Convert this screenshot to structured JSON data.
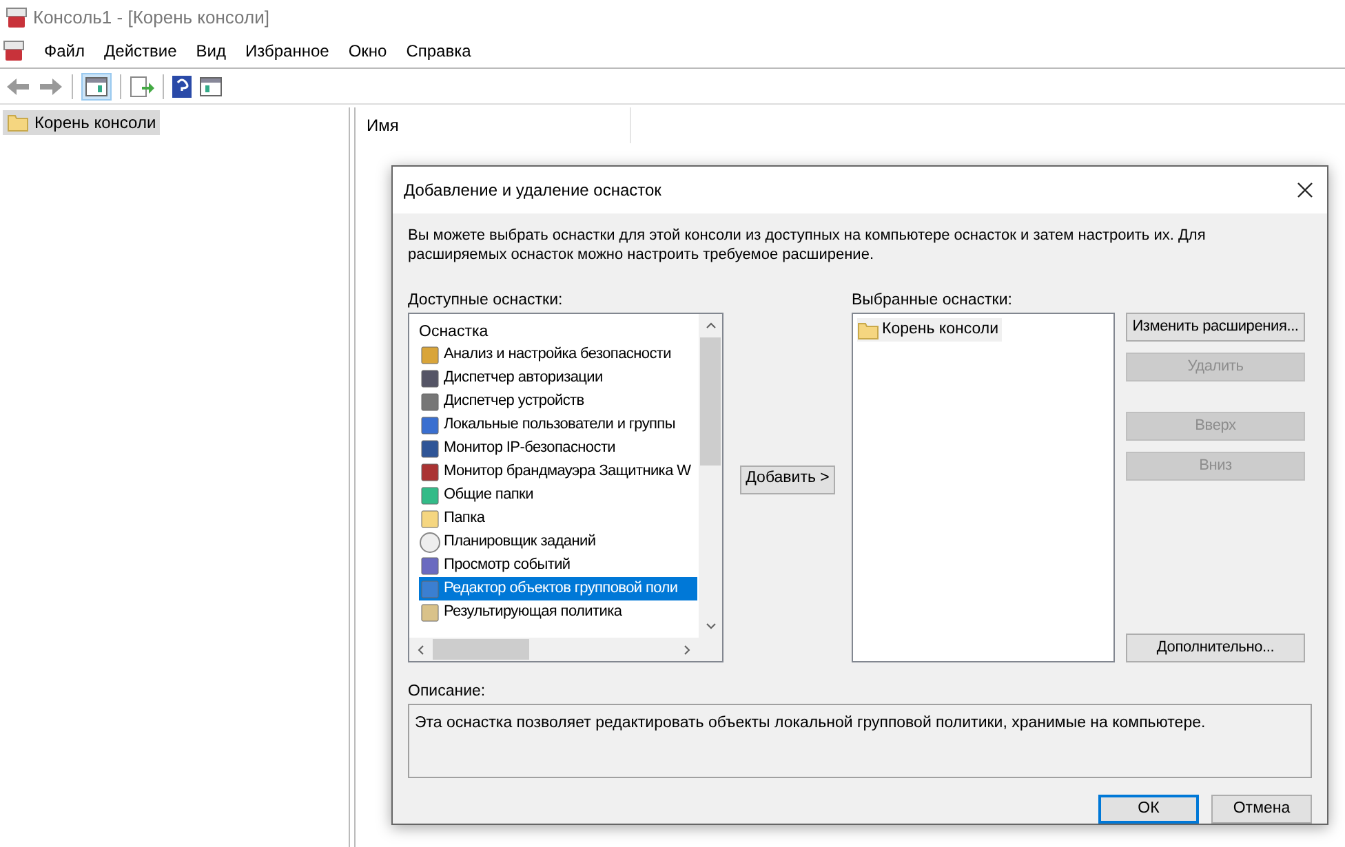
{
  "window": {
    "title": "Консоль1 - [Корень консоли]"
  },
  "menu": [
    "Файл",
    "Действие",
    "Вид",
    "Избранное",
    "Окно",
    "Справка"
  ],
  "toolbar": {
    "tree_toggle_on": true
  },
  "tree": [
    {
      "label": "Корень консоли",
      "selected": true
    }
  ],
  "list_header": "Имя",
  "dialog": {
    "title": "Добавление и удаление оснасток",
    "intro": "Вы можете выбрать оснастки для этой консоли из доступных на компьютере оснасток и затем настроить их. Для расширяемых оснасток можно настроить требуемое расширение.",
    "available_label": "Доступные оснастки:",
    "available_header": "Оснастка",
    "available": [
      {
        "label": "Анализ и настройка безопасности",
        "selected": false
      },
      {
        "label": "Диспетчер авторизации",
        "selected": false
      },
      {
        "label": "Диспетчер устройств",
        "selected": false
      },
      {
        "label": "Локальные пользователи и группы",
        "selected": false
      },
      {
        "label": "Монитор IP-безопасности",
        "selected": false
      },
      {
        "label": "Монитор брандмауэра Защитника W",
        "selected": false
      },
      {
        "label": "Общие папки",
        "selected": false
      },
      {
        "label": "Папка",
        "selected": false
      },
      {
        "label": "Планировщик заданий",
        "selected": false
      },
      {
        "label": "Просмотр событий",
        "selected": false
      },
      {
        "label": "Редактор объектов групповой поли",
        "selected": true
      },
      {
        "label": "Результирующая политика",
        "selected": false
      }
    ],
    "add_button": "Добавить >",
    "selected_label": "Выбранные оснастки:",
    "selected_items": [
      "Корень консоли"
    ],
    "side_buttons": [
      {
        "label": "Изменить расширения...",
        "disabled": false
      },
      {
        "label": "Удалить",
        "disabled": true
      },
      {
        "label": "Вверх",
        "disabled": true
      },
      {
        "label": "Вниз",
        "disabled": true
      },
      {
        "label": "Дополнительно...",
        "disabled": false
      }
    ],
    "description_label": "Описание:",
    "description": "Эта оснастка позволяет редактировать объекты локальной групповой политики, хранимые на компьютере.",
    "ok": "ОК",
    "cancel": "Отмена"
  }
}
